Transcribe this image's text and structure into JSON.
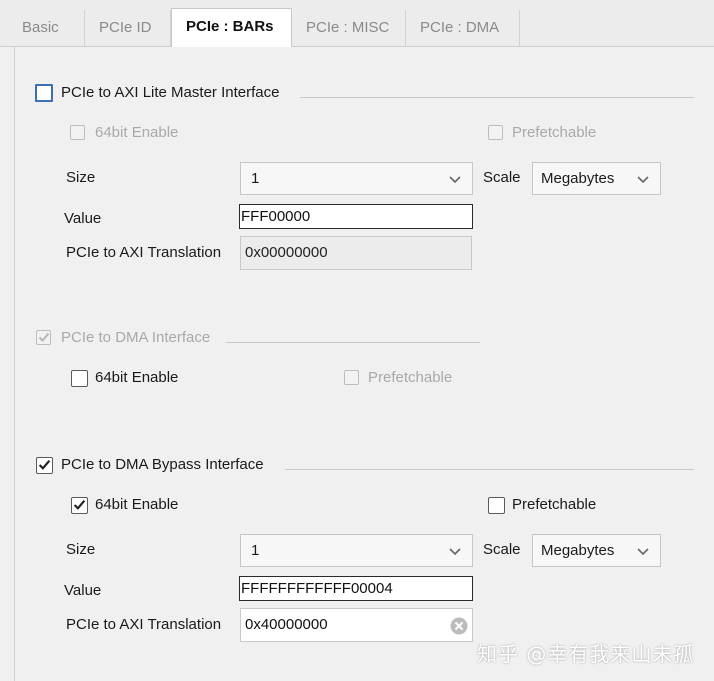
{
  "tabs": [
    "Basic",
    "PCIe ID",
    "PCIe : BARs",
    "PCIe : MISC",
    "PCIe : DMA"
  ],
  "active_tab": "PCIe : BARs",
  "axi_lite": {
    "title": "PCIe to AXI Lite Master Interface",
    "checked": false,
    "bit64_label": "64bit Enable",
    "prefetch_label": "Prefetchable",
    "size_label": "Size",
    "size_value": "1",
    "scale_label": "Scale",
    "scale_value": "Megabytes",
    "value_label": "Value",
    "value": "FFF00000",
    "translation_label": "PCIe to AXI Translation",
    "translation_value": "0x00000000"
  },
  "dma": {
    "title": "PCIe to DMA Interface",
    "checked": true,
    "bit64_label": "64bit Enable",
    "prefetch_label": "Prefetchable"
  },
  "bypass": {
    "title": "PCIe to DMA Bypass Interface",
    "checked": true,
    "bit64_label": "64bit Enable",
    "bit64_checked": true,
    "prefetch_label": "Prefetchable",
    "size_label": "Size",
    "size_value": "1",
    "scale_label": "Scale",
    "scale_value": "Megabytes",
    "value_label": "Value",
    "value": "FFFFFFFFFFFF00004",
    "translation_label": "PCIe to AXI Translation",
    "translation_value": "0x40000000"
  },
  "watermark": "知乎 @幸有我来山未孤",
  "colors": {
    "focus_blue": "#3d6fb6",
    "check": "#222222",
    "disabled": "#a9a9a9"
  }
}
